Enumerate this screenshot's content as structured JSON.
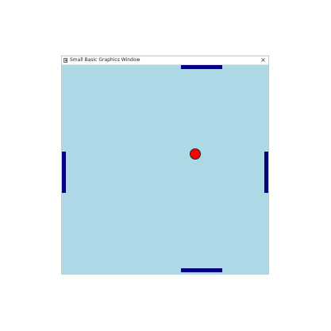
{
  "window": {
    "title": "Small Basic Graphics Window",
    "close_glyph": "×",
    "icon": "small-basic-app-icon"
  },
  "canvas": {
    "background_color": "#add8e6"
  },
  "paddles": {
    "color": "#000080",
    "items": [
      "top",
      "bottom",
      "left",
      "right"
    ]
  },
  "ball": {
    "fill_color": "#ff0000",
    "outline_color": "#222222"
  }
}
